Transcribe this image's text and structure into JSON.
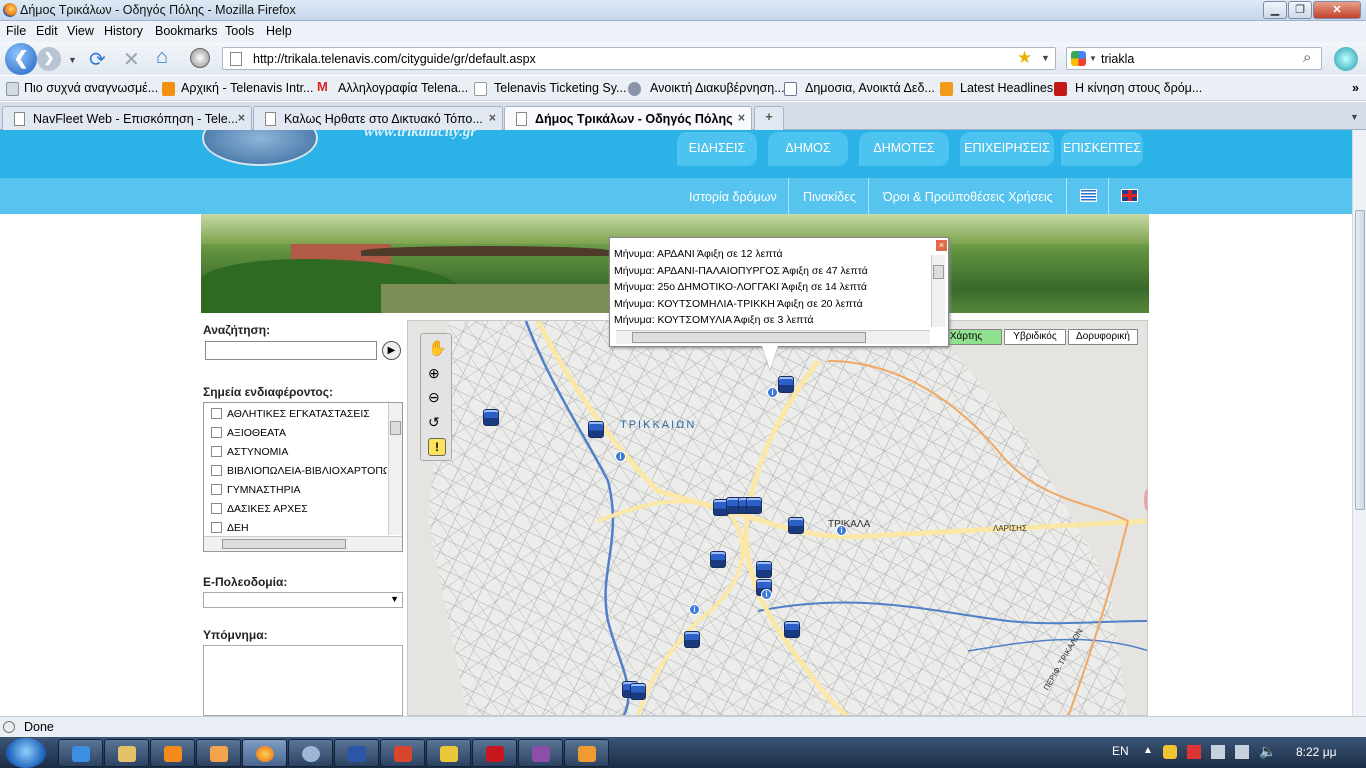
{
  "window": {
    "title": "Δήμος Τρικάλων - Οδηγός Πόλης - Mozilla Firefox"
  },
  "menu": [
    "File",
    "Edit",
    "View",
    "History",
    "Bookmarks",
    "Tools",
    "Help"
  ],
  "address": {
    "url": "http://trikala.telenavis.com/cityguide/gr/default.aspx"
  },
  "search": {
    "value": "triakla"
  },
  "bookmarks": [
    "Πιο συχνά αναγνωσμέ...",
    "Αρχική - Telenavis Intr...",
    "Αλληλογραφία Telena...",
    "Telenavis Ticketing Sy...",
    "Ανοικτή Διακυβέρνηση...",
    "Δημοσια, Ανοικτά Δεδ...",
    "Latest Headlines",
    "Η κίνηση στους δρόμ..."
  ],
  "tabs": [
    "NavFleet Web - Επισκόπηση - Tele...",
    "Καλως Ηρθατε στο Δικτυακό Τόπο...",
    "Δήμος Τρικάλων - Οδηγός Πόλης"
  ],
  "site": {
    "logo_text": "www.trikalacity.gr",
    "nav": [
      "ΕΙΔΗΣΕΙΣ",
      "ΔΗΜΟΣ",
      "ΔΗΜΟΤΕΣ",
      "ΕΠΙΧΕΙΡΗΣΕΙΣ",
      "ΕΠΙΣΚΕΠΤΕΣ"
    ],
    "subnav": [
      "Ιστορία δρόμων",
      "Πινακίδες",
      "Όροι & Προϋποθέσεις Χρήσεις"
    ]
  },
  "left": {
    "search_label": "Αναζήτηση:",
    "poi_label": "Σημεία ενδιαφέροντος:",
    "poi_items": [
      "ΑΘΛΗΤΙΚΕΣ ΕΓΚΑΤΑΣΤΑΣΕΙΣ",
      "ΑΞΙΟΘΕΑΤΑ",
      "ΑΣΤΥΝΟΜΙΑ",
      "ΒΙΒΛΙΟΠΩΛΕΙΑ-ΒΙΒΛΙΟΧΑΡΤΟΠΩ",
      "ΓΥΜΝΑΣΤΗΡΙΑ",
      "ΔΑΣΙΚΕΣ ΑΡΧΕΣ",
      "ΔΕΗ"
    ],
    "planning_label": "Ε-Πολεοδομία:",
    "legend_label": "Υπόμνημα:"
  },
  "popup": {
    "messages": [
      "Μήνυμα: ΑΡΔΑΝΙ Άφιξη σε 12 λεπτά",
      "Μήνυμα: ΑΡΔΑΝΙ-ΠΑΛΑΙΟΠΥΡΓΟΣ Άφιξη σε 47 λεπτά",
      "Μήνυμα: 25ο ΔΗΜΟΤΙΚΟ-ΛΟΓΓΑΚΙ Άφιξη σε 14 λεπτά",
      "Μήνυμα: ΚΟΥΤΣΟΜΗΛΙΑ-ΤΡΙΚΚΗ Άφιξη σε 20 λεπτά",
      "Μήνυμα: ΚΟΥΤΣΟΜΥΛΙΑ Άφιξη σε 3 λεπτά"
    ]
  },
  "map": {
    "types": [
      "Χάρτης",
      "Υβριδικός",
      "Δορυφορική"
    ],
    "labels": {
      "area1": "ΤΡΙΚΚΑΙΩΝ",
      "area2": "ΤΡΙΚΑΛΑ",
      "road1": "ΛΑΡΙΣΗΣ",
      "road2": "ΠΕΡΙΦ. ΤΡΙΚΑΛΩΝ"
    }
  },
  "status": {
    "text": "Done"
  },
  "tray": {
    "lang": "EN",
    "time": "8:22 μμ"
  },
  "colors": {
    "site_blue": "#2bb2e6",
    "map_type_active": "#8fe08f",
    "bus_blue": "#2d5fc8"
  }
}
